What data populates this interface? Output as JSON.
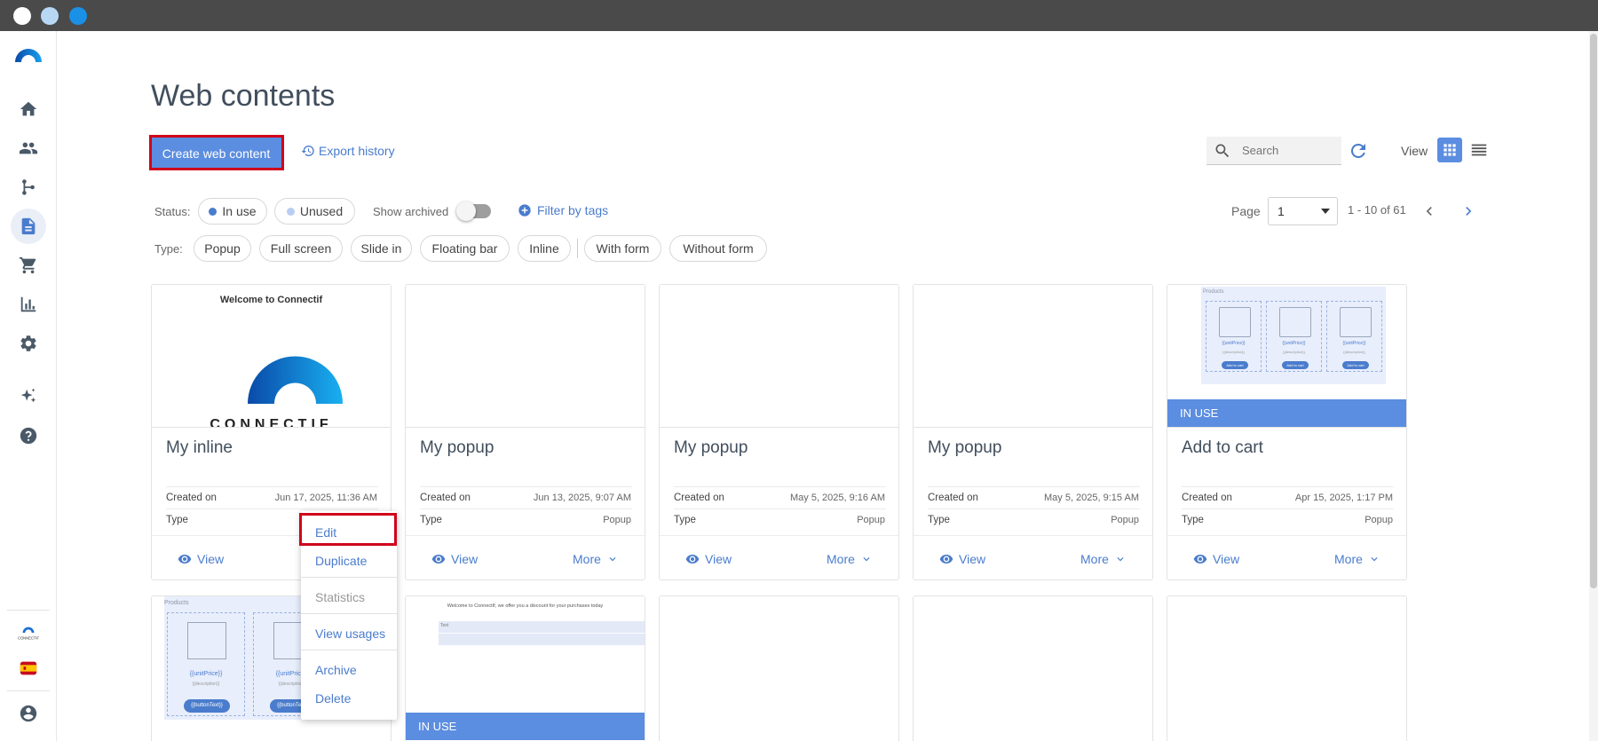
{
  "window": {
    "dots": [
      "#ffffff",
      "#b7d8f5",
      "#1a90e6"
    ]
  },
  "colors": {
    "accent": "#5b8de0",
    "link": "#4a7ccd",
    "highlight": "#d0021b"
  },
  "sidebar": {
    "items": [
      {
        "icon": "home-icon"
      },
      {
        "icon": "contacts-icon"
      },
      {
        "icon": "workflows-icon"
      },
      {
        "icon": "web-contents-icon",
        "active": true
      },
      {
        "icon": "cart-icon"
      },
      {
        "icon": "reports-icon"
      },
      {
        "icon": "settings-icon"
      },
      {
        "icon": "sparkles-icon"
      },
      {
        "icon": "help-icon"
      }
    ],
    "account_logo_text": "CONNECTIF",
    "language_flag": "es"
  },
  "header": {
    "title": "Web contents",
    "create_label": "Create web content",
    "export_label": "Export history",
    "search_placeholder": "Search",
    "view_label": "View"
  },
  "filters": {
    "status_label": "Status:",
    "in_use_label": "In use",
    "unused_label": "Unused",
    "show_archived_label": "Show archived",
    "show_archived": false,
    "filter_tags_label": "Filter by tags",
    "type_label": "Type:",
    "types": [
      "Popup",
      "Full screen",
      "Slide in",
      "Floating bar",
      "Inline"
    ],
    "form_types": [
      "With form",
      "Without form"
    ]
  },
  "pager": {
    "page_label": "Page",
    "current_page": "1",
    "range": "1 - 10 of 61"
  },
  "cards": [
    {
      "name": "My inline",
      "created_label": "Created on",
      "created": "Jun 17, 2025, 11:36 AM",
      "type_label": "Type",
      "type": "",
      "in_use": false,
      "view_label": "View",
      "more_label": "More",
      "thumb_title": "Welcome to Connectif",
      "thumb_logo_text": "CONNECTIF"
    },
    {
      "name": "My popup",
      "created_label": "Created on",
      "created": "Jun 13, 2025, 9:07 AM",
      "type_label": "Type",
      "type": "Popup",
      "in_use": false,
      "view_label": "View",
      "more_label": "More"
    },
    {
      "name": "My popup",
      "created_label": "Created on",
      "created": "May 5, 2025, 9:16 AM",
      "type_label": "Type",
      "type": "Popup",
      "in_use": false,
      "view_label": "View",
      "more_label": "More"
    },
    {
      "name": "My popup",
      "created_label": "Created on",
      "created": "May 5, 2025, 9:15 AM",
      "type_label": "Type",
      "type": "Popup",
      "in_use": false,
      "view_label": "View",
      "more_label": "More"
    },
    {
      "name": "Add to cart",
      "created_label": "Created on",
      "created": "Apr 15, 2025, 1:17 PM",
      "type_label": "Type",
      "type": "Popup",
      "in_use": true,
      "in_use_label": "IN USE",
      "view_label": "View",
      "more_label": "More",
      "thumb_heading": "Products",
      "product_price": "{{unitPrice}}",
      "product_desc": "{{description}}",
      "product_button": "Add to cart"
    }
  ],
  "cards_row2": [
    {
      "in_use": false,
      "thumb_heading": "Products",
      "product_price": "{{unitPrice}}",
      "product_desc": "{{description}}",
      "product_button": "{{buttonText}}"
    },
    {
      "in_use": true,
      "in_use_label": "IN USE",
      "thumb_text": "Welcome to ConnectIf, we offer you a discount for your purchases today",
      "thumb_field_label": "Text"
    },
    {
      "in_use": false
    },
    {
      "in_use": false
    },
    {
      "in_use": false
    }
  ],
  "context_menu": {
    "items": [
      {
        "label": "Edit",
        "disabled": false,
        "highlighted": true
      },
      {
        "label": "Duplicate",
        "disabled": false
      },
      {
        "label": "Statistics",
        "disabled": true
      },
      {
        "label": "View usages",
        "disabled": false
      },
      {
        "label": "Archive",
        "disabled": false
      },
      {
        "label": "Delete",
        "disabled": false
      }
    ]
  }
}
